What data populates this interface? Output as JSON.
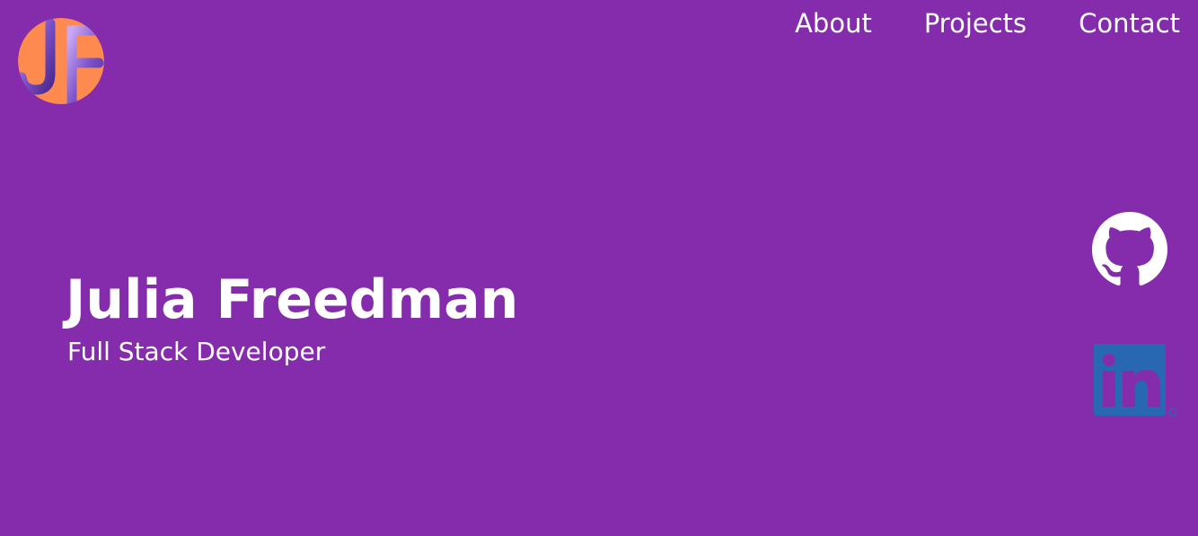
{
  "logo": {
    "text": "JF",
    "icon": "jf-monogram-logo",
    "colors": {
      "background": "#ff8a4f",
      "letters": "#7b52c9"
    }
  },
  "nav": {
    "items": [
      {
        "label": "About"
      },
      {
        "label": "Projects"
      },
      {
        "label": "Contact"
      }
    ]
  },
  "hero": {
    "name": "Julia Freedman",
    "role": "Full Stack Developer"
  },
  "social": {
    "github": {
      "icon": "github-icon",
      "color": "#ffffff"
    },
    "linkedin": {
      "icon": "linkedin-icon",
      "color": "#2867b2"
    }
  },
  "theme": {
    "background": "#842cac",
    "text": "#ffffff"
  }
}
